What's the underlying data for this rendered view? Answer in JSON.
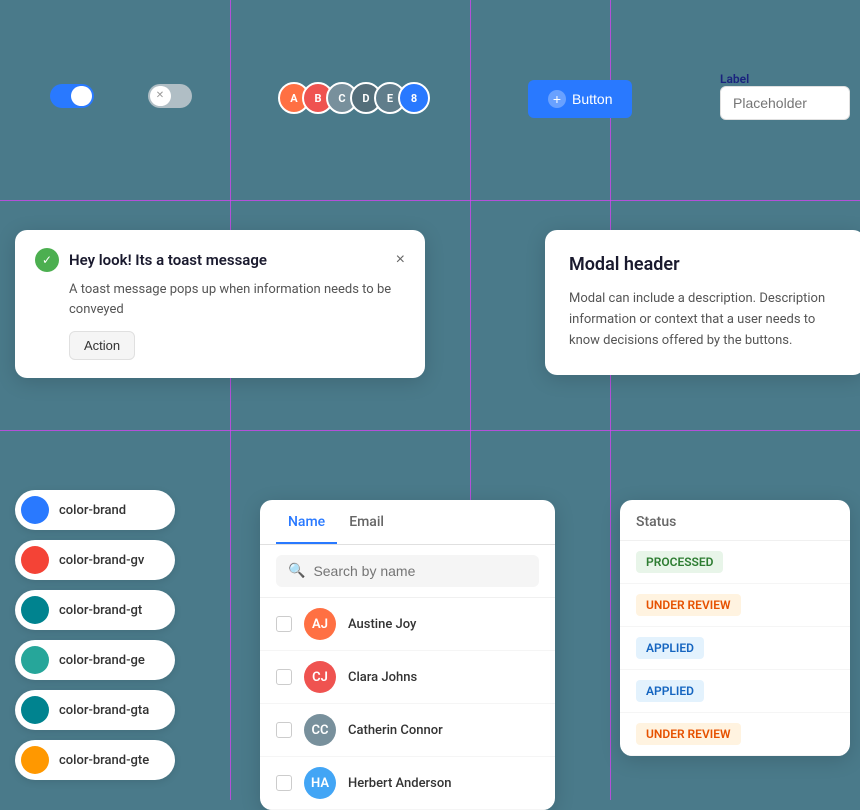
{
  "colors": {
    "background": "#4a7a8a",
    "primary": "#2979ff",
    "grid_line": "#e040fb"
  },
  "toggles": {
    "toggle_on_label": "toggle-on",
    "toggle_off_label": "toggle-off"
  },
  "avatar_group": {
    "count": 8
  },
  "button": {
    "label": "Button",
    "plus_icon": "+"
  },
  "input": {
    "label": "Label",
    "placeholder": "Placeholder"
  },
  "toast": {
    "title": "Hey look! Its a toast message",
    "body": "A toast message pops up when information needs to be conveyed",
    "action_label": "Action",
    "close_label": "×"
  },
  "modal": {
    "title": "Modal header",
    "body": "Modal can include a description. Description information or context that a user needs to know decisions offered by the buttons."
  },
  "color_swatches": [
    {
      "id": "brand",
      "label": "color-brand",
      "color": "#2979ff"
    },
    {
      "id": "brand-gv",
      "label": "color-brand-gv",
      "color": "#f44336"
    },
    {
      "id": "brand-gt",
      "label": "color-brand-gt",
      "color": "#00838f"
    },
    {
      "id": "brand-ge",
      "label": "color-brand-ge",
      "color": "#26a69a"
    },
    {
      "id": "brand-gta",
      "label": "color-brand-gta",
      "color": "#00838f"
    },
    {
      "id": "brand-gte",
      "label": "color-brand-gte",
      "color": "#ff9800"
    }
  ],
  "list": {
    "tabs": [
      {
        "id": "name",
        "label": "Name",
        "active": true
      },
      {
        "id": "email",
        "label": "Email",
        "active": false
      }
    ],
    "search_placeholder": "Search by name",
    "items": [
      {
        "id": 1,
        "name": "Austine Joy",
        "initials": "AJ",
        "color": "#ff7043"
      },
      {
        "id": 2,
        "name": "Clara Johns",
        "initials": "CJ",
        "color": "#ef5350"
      },
      {
        "id": 3,
        "name": "Catherin Connor",
        "initials": "CC",
        "color": "#78909c"
      },
      {
        "id": 4,
        "name": "Herbert Anderson",
        "initials": "HA",
        "color": "#42a5f5"
      }
    ]
  },
  "status": {
    "header": "Status",
    "items": [
      {
        "id": 1,
        "label": "PROCESSED",
        "type": "processed"
      },
      {
        "id": 2,
        "label": "UNDER REVIEW",
        "type": "under-review"
      },
      {
        "id": 3,
        "label": "APPLIED",
        "type": "applied"
      },
      {
        "id": 4,
        "label": "APPLIED",
        "type": "applied"
      },
      {
        "id": 5,
        "label": "UNDER REVIEW",
        "type": "under-review"
      }
    ]
  }
}
